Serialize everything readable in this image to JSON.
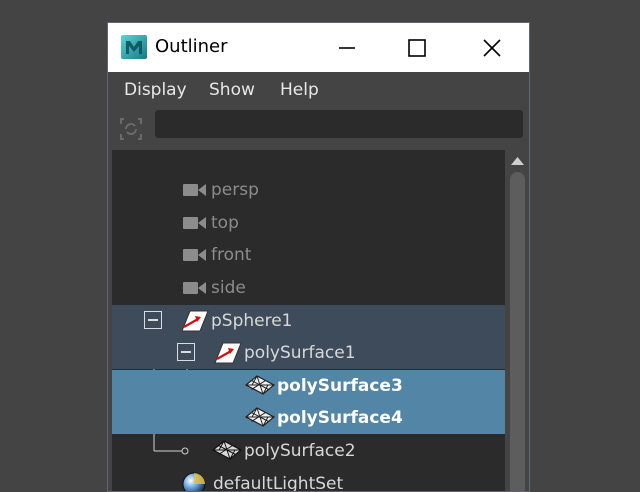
{
  "window": {
    "title": "Outliner",
    "app_icon": "maya-icon",
    "controls": {
      "minimize": "minimize-icon",
      "maximize": "maximize-icon",
      "close": "close-icon"
    }
  },
  "menu": {
    "items": [
      {
        "label": "Display"
      },
      {
        "label": "Show"
      },
      {
        "label": "Help"
      }
    ]
  },
  "search": {
    "value": "",
    "placeholder": ""
  },
  "tree": {
    "rows": [
      {
        "label": "persp",
        "icon": "camera-icon",
        "state": "dimmed"
      },
      {
        "label": "top",
        "icon": "camera-icon",
        "state": "dimmed"
      },
      {
        "label": "front",
        "icon": "camera-icon",
        "state": "dimmed"
      },
      {
        "label": "side",
        "icon": "camera-icon",
        "state": "dimmed"
      },
      {
        "label": "pSphere1",
        "icon": "transform-icon",
        "state": "expanded-parent"
      },
      {
        "label": "polySurface1",
        "icon": "transform-icon",
        "state": "expanded-parent"
      },
      {
        "label": "polySurface3",
        "icon": "mesh-icon",
        "state": "selected"
      },
      {
        "label": "polySurface4",
        "icon": "mesh-icon",
        "state": "selected"
      },
      {
        "label": "polySurface2",
        "icon": "mesh-icon",
        "state": "normal"
      },
      {
        "label": "defaultLightSet",
        "icon": "light-set-icon",
        "state": "normal"
      }
    ]
  },
  "colors": {
    "background": "#444444",
    "tree_bg": "#2b2b2b",
    "selection": "#5285a6",
    "parent_highlight": "#3e4b5a"
  }
}
